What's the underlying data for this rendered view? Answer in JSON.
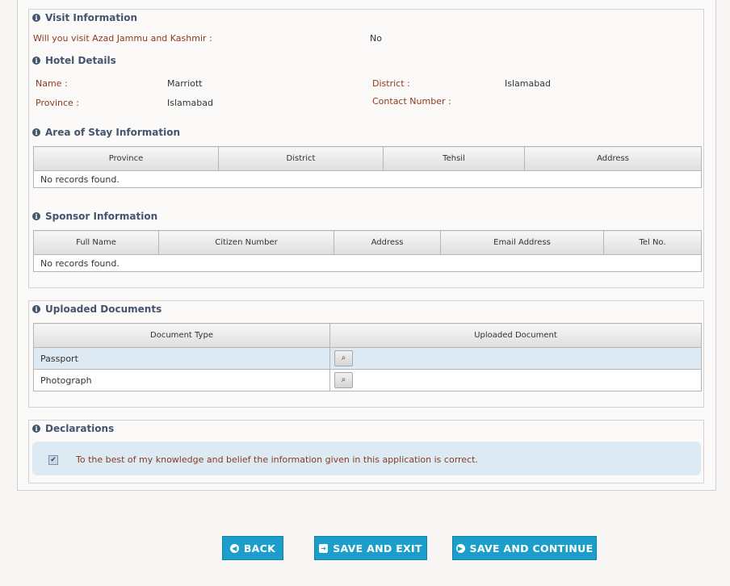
{
  "visit_info": {
    "title": "Visit Information",
    "ajk_label": "Will you visit Azad Jammu and Kashmir :",
    "ajk_value": "No"
  },
  "hotel": {
    "title": "Hotel Details",
    "name_label": "Name :",
    "name_value": "Marriott",
    "district_label": "District :",
    "district_value": "Islamabad",
    "province_label": "Province :",
    "province_value": "Islamabad",
    "contact_label": "Contact Number :",
    "contact_value": ""
  },
  "area_of_stay": {
    "title": "Area of Stay Information",
    "columns": [
      "Province",
      "District",
      "Tehsil",
      "Address"
    ],
    "empty_text": "No records found."
  },
  "sponsor": {
    "title": "Sponsor Information",
    "columns": [
      "Full Name",
      "Citizen Number",
      "Address",
      "Email Address",
      "Tel No."
    ],
    "empty_text": "No records found."
  },
  "documents": {
    "title": "Uploaded Documents",
    "columns": [
      "Document Type",
      "Uploaded Document"
    ],
    "rows": [
      {
        "type": "Passport"
      },
      {
        "type": "Photograph"
      }
    ]
  },
  "declarations": {
    "title": "Declarations",
    "text": "To the best of my knowledge and belief the information given in this application is correct.",
    "checked": true
  },
  "buttons": {
    "back": "BACK",
    "save_exit": "SAVE AND EXIT",
    "save_continue": "SAVE AND CONTINUE"
  },
  "icons": {
    "section": "info-icon",
    "view": "magnifier-icon",
    "back": "arrow-left-circle-icon",
    "save_exit": "sign-out-icon",
    "save_continue": "arrow-right-circle-icon"
  },
  "colors": {
    "accent": "#1b9ec9",
    "label": "#8b3a1c",
    "heading": "#44546e",
    "highlight_row": "#dde9f3"
  }
}
